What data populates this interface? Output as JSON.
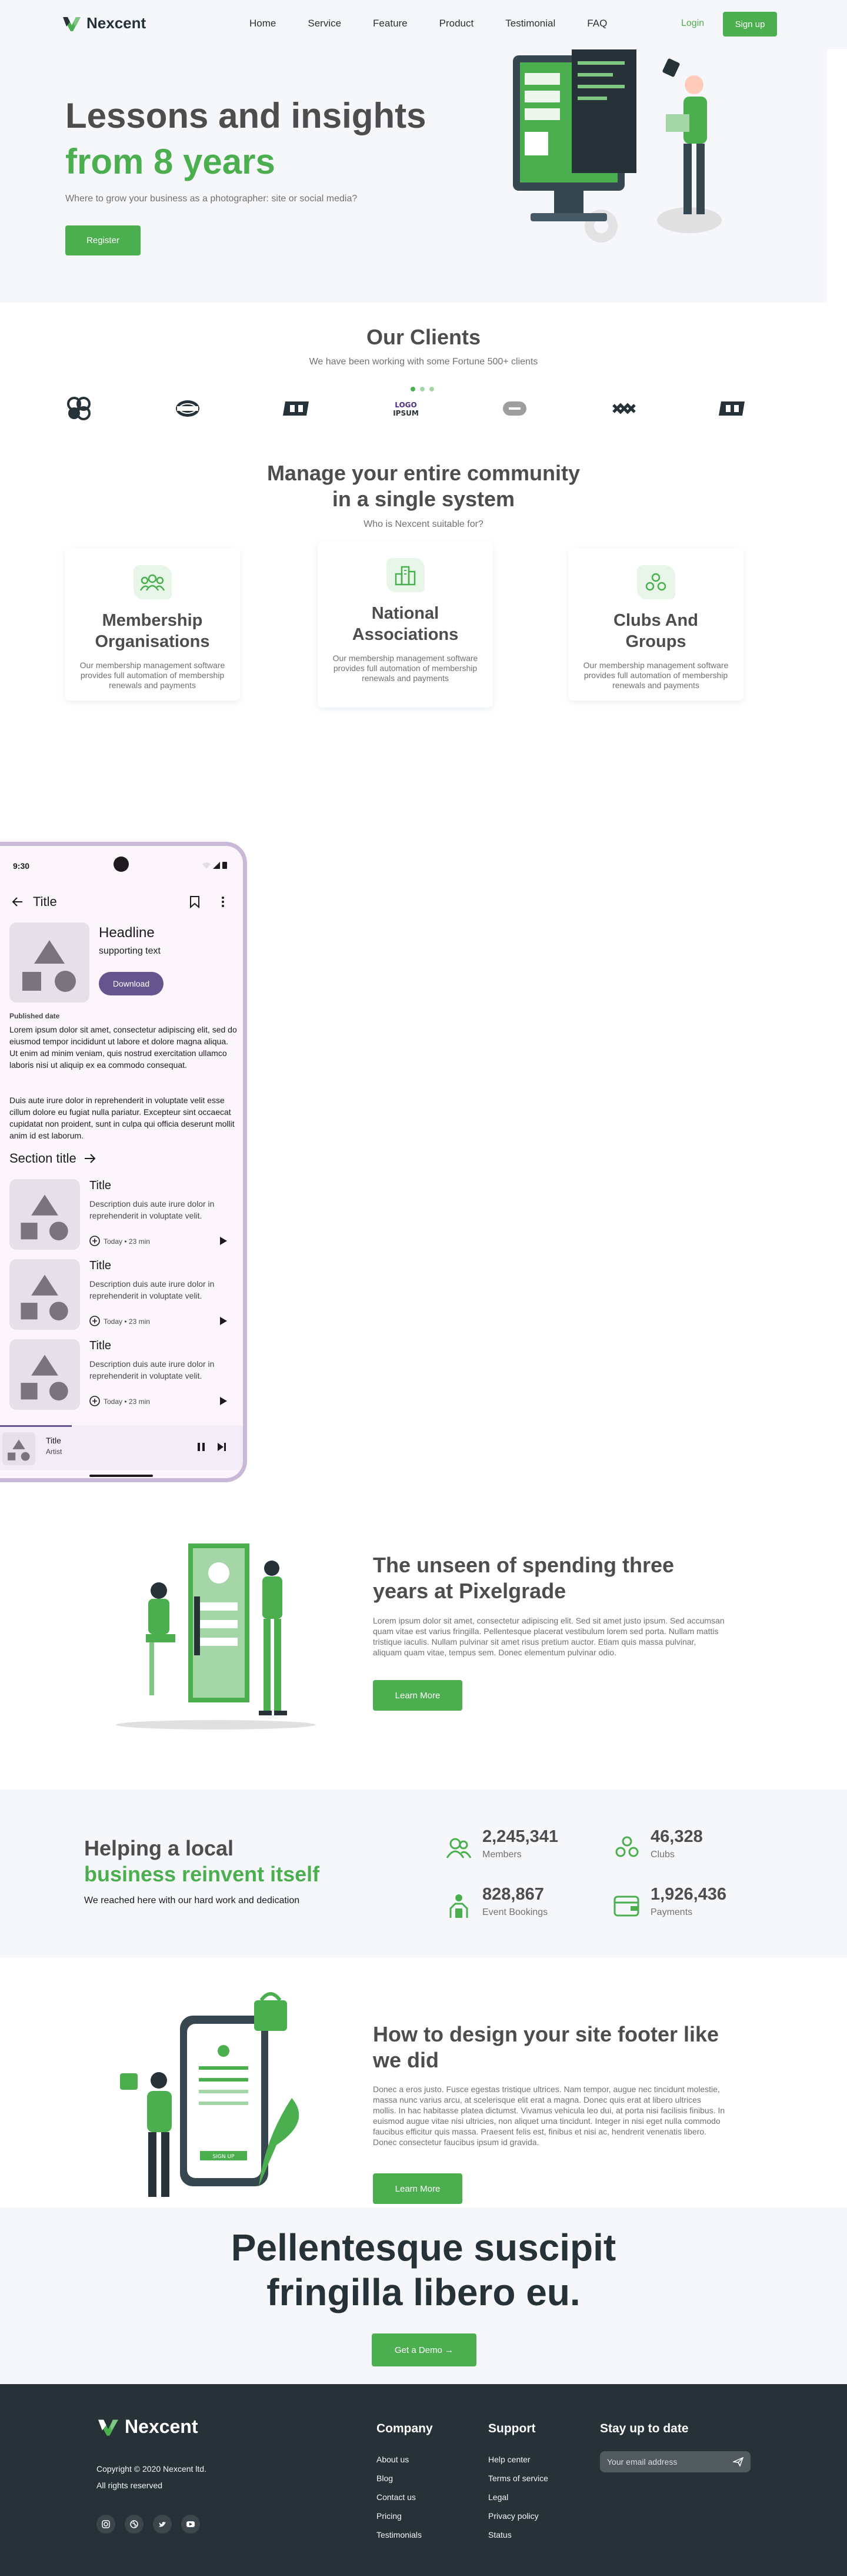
{
  "nav": {
    "brand": "Nexcent",
    "links": [
      "Home",
      "Service",
      "Feature",
      "Product",
      "Testimonial",
      "FAQ"
    ],
    "login": "Login",
    "signup": "Sign up"
  },
  "hero": {
    "title_line1": "Lessons and insights",
    "title_line2": "from 8 years",
    "subtitle": "Where to grow your business as a photographer: site or social media?",
    "cta": "Register"
  },
  "clients": {
    "title": "Our Clients",
    "subtitle": "We have been working with some Fortune 500+ clients"
  },
  "community": {
    "title_line1": "Manage your entire community",
    "title_line2": "in a single system",
    "subtitle": "Who is Nexcent suitable for?",
    "cards": [
      {
        "title_line1": "Membership",
        "title_line2": "Organisations",
        "desc": "Our membership management software provides full automation of membership renewals and payments"
      },
      {
        "title_line1": "National",
        "title_line2": "Associations",
        "desc": "Our membership management software provides full automation of membership renewals and payments"
      },
      {
        "title_line1": "Clubs And",
        "title_line2": "Groups",
        "desc": "Our membership management software provides full automation of membership renewals and payments"
      }
    ]
  },
  "phone": {
    "time": "9:30",
    "appbar_title": "Title",
    "headline": "Headline",
    "supporting": "supporting text",
    "download": "Download",
    "published": "Published date",
    "body1": "Lorem ipsum dolor sit amet, consectetur adipiscing elit, sed do eiusmod tempor incididunt ut labore et dolore magna aliqua. Ut enim ad minim veniam, quis nostrud exercitation ullamco laboris nisi ut aliquip ex ea commodo consequat.",
    "body2": "Duis aute irure dolor in reprehenderit in voluptate velit esse cillum dolore eu fugiat nulla pariatur. Excepteur sint occaecat cupidatat non proident, sunt in culpa qui officia deserunt mollit anim id est laborum.",
    "section_title": "Section title",
    "items": [
      {
        "title": "Title",
        "desc": "Description duis aute irure dolor in reprehenderit in voluptate velit.",
        "meta": "Today • 23 min"
      },
      {
        "title": "Title",
        "desc": "Description duis aute irure dolor in reprehenderit in voluptate velit.",
        "meta": "Today • 23 min"
      },
      {
        "title": "Title",
        "desc": "Description duis aute irure dolor in reprehenderit in voluptate velit.",
        "meta": "Today • 23 min"
      }
    ],
    "player_title": "Title",
    "player_artist": "Artist"
  },
  "unseen": {
    "title_line1": "The unseen of spending three",
    "title_line2": "years at Pixelgrade",
    "desc": "Lorem ipsum dolor sit amet, consectetur adipiscing elit. Sed sit amet justo ipsum. Sed accumsan quam vitae est varius fringilla. Pellentesque placerat vestibulum lorem sed porta. Nullam mattis tristique iaculis. Nullam pulvinar sit amet risus pretium auctor. Etiam quis massa pulvinar, aliquam quam vitae, tempus sem. Donec elementum pulvinar odio.",
    "cta": "Learn More"
  },
  "stats": {
    "title_line1": "Helping a local",
    "title_line2": "business reinvent itself",
    "subtitle": "We reached here with our hard work and dedication",
    "items": [
      {
        "num": "2,245,341",
        "label": "Members"
      },
      {
        "num": "46,328",
        "label": "Clubs"
      },
      {
        "num": "828,867",
        "label": "Event Bookings"
      },
      {
        "num": "1,926,436",
        "label": "Payments"
      }
    ]
  },
  "footer_design": {
    "title_line1": "How to design your site footer like",
    "title_line2": "we did",
    "desc": "Donec a eros justo. Fusce egestas tristique ultrices. Nam tempor, augue nec tincidunt molestie, massa nunc varius arcu, at scelerisque elit erat a magna. Donec quis erat at libero ultrices mollis. In hac habitasse platea dictumst. Vivamus vehicula leo dui, at porta nisi facilisis finibus. In euismod augue vitae nisi ultricies, non aliquet urna tincidunt. Integer in nisi eget nulla commodo faucibus efficitur quis massa. Praesent felis est, finibus et nisi ac, hendrerit venenatis libero. Donec consectetur faucibus ipsum id gravida.",
    "cta": "Learn More",
    "phone_button": "SIGN UP"
  },
  "banner": {
    "title_line1": "Pellentesque suscipit",
    "title_line2": "fringilla libero eu.",
    "cta": "Get a Demo →"
  },
  "footer": {
    "brand": "Nexcent",
    "copyright": "Copyright © 2020 Nexcent ltd.",
    "rights": "All rights reserved",
    "company_head": "Company",
    "company_links": [
      "About us",
      "Blog",
      "Contact us",
      "Pricing",
      "Testimonials"
    ],
    "support_head": "Support",
    "support_links": [
      "Help center",
      "Terms of service",
      "Legal",
      "Privacy policy",
      "Status"
    ],
    "newsletter_head": "Stay up to date",
    "email_placeholder": "Your email address"
  },
  "colors": {
    "primary": "#4CAF4F",
    "dark": "#263238",
    "silver": "#F5F7FA",
    "phone_frame": "#C9B8D6",
    "phone_button": "#65558F"
  }
}
